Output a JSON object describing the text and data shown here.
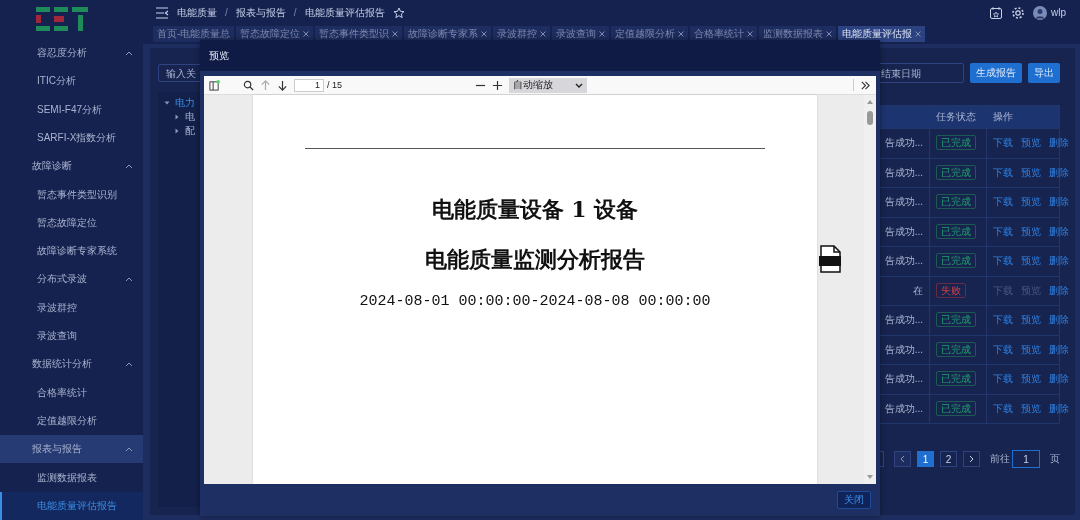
{
  "sidebar": {
    "items": [
      {
        "label": "容忍度分析",
        "kind": "subgroup",
        "expanded": true,
        "children": [
          {
            "label": "ITIC分析",
            "kind": "leaf",
            "selected": false
          },
          {
            "label": "SEMI-F47分析",
            "kind": "leaf",
            "selected": false
          },
          {
            "label": "SARFI-X指数分析",
            "kind": "leaf",
            "selected": false
          }
        ]
      },
      {
        "label": "故障诊断",
        "kind": "group",
        "expanded": true,
        "children": [
          {
            "label": "暂态事件类型识别",
            "kind": "leaf",
            "selected": false
          },
          {
            "label": "暂态故障定位",
            "kind": "leaf",
            "selected": false
          },
          {
            "label": "故障诊断专家系统",
            "kind": "leaf",
            "selected": false
          },
          {
            "label": "分布式录波",
            "kind": "subgroup",
            "expanded": true,
            "children": [
              {
                "label": "录波群控",
                "kind": "leaf",
                "selected": false
              },
              {
                "label": "录波查询",
                "kind": "leaf",
                "selected": false
              }
            ]
          }
        ]
      },
      {
        "label": "数据统计分析",
        "kind": "group",
        "expanded": true,
        "children": [
          {
            "label": "合格率统计",
            "kind": "leaf",
            "selected": false
          },
          {
            "label": "定值越限分析",
            "kind": "leaf",
            "selected": false
          }
        ]
      },
      {
        "label": "报表与报告",
        "kind": "group",
        "expanded": true,
        "children": [
          {
            "label": "监测数据报表",
            "kind": "leaf",
            "selected": false
          },
          {
            "label": "电能质量评估报告",
            "kind": "leaf",
            "selected": true
          }
        ]
      }
    ]
  },
  "breadcrumb": [
    "电能质量",
    "报表与报告",
    "电能质量评估报告"
  ],
  "breadcrumb_separator": "/",
  "user": {
    "name": "wlp"
  },
  "tabs": [
    {
      "label": "首页-电能质量总",
      "closable": false,
      "selected": false
    },
    {
      "label": "暂态故障定位",
      "closable": true,
      "selected": false
    },
    {
      "label": "暂态事件类型识",
      "closable": true,
      "selected": false
    },
    {
      "label": "故障诊断专家系",
      "closable": true,
      "selected": false
    },
    {
      "label": "录波群控",
      "closable": true,
      "selected": false
    },
    {
      "label": "录波查询",
      "closable": true,
      "selected": false
    },
    {
      "label": "定值越限分析",
      "closable": true,
      "selected": false
    },
    {
      "label": "合格率统计",
      "closable": true,
      "selected": false
    },
    {
      "label": "监测数据报表",
      "closable": true,
      "selected": false
    },
    {
      "label": "电能质量评估报",
      "closable": true,
      "selected": true
    }
  ],
  "toolbar": {
    "search": {
      "placeholder": "输入关"
    },
    "end_date": {
      "placeholder": "结束日期"
    },
    "buttons": [
      "生成报告",
      "导出"
    ]
  },
  "tree": [
    {
      "label": "电力",
      "expanded": true,
      "selected": true,
      "children": [
        {
          "label": "电",
          "expanded": false,
          "selected": false
        },
        {
          "label": "配",
          "expanded": false,
          "selected": false
        }
      ]
    }
  ],
  "table": {
    "columns": [
      "任务状态",
      "操作"
    ],
    "rows": [
      {
        "column_1": "告成功...",
        "status": {
          "text": "已完成",
          "kind": "success"
        },
        "actions": [
          {
            "label": "下载",
            "disabled": false
          },
          {
            "label": "预览",
            "disabled": false
          },
          {
            "label": "删除",
            "disabled": false
          }
        ]
      },
      {
        "column_1": "告成功...",
        "status": {
          "text": "已完成",
          "kind": "success"
        },
        "actions": [
          {
            "label": "下载",
            "disabled": false
          },
          {
            "label": "预览",
            "disabled": false
          },
          {
            "label": "删除",
            "disabled": false
          }
        ]
      },
      {
        "column_1": "告成功...",
        "status": {
          "text": "已完成",
          "kind": "success"
        },
        "actions": [
          {
            "label": "下载",
            "disabled": false
          },
          {
            "label": "预览",
            "disabled": false
          },
          {
            "label": "删除",
            "disabled": false
          }
        ]
      },
      {
        "column_1": "告成功...",
        "status": {
          "text": "已完成",
          "kind": "success"
        },
        "actions": [
          {
            "label": "下载",
            "disabled": false
          },
          {
            "label": "预览",
            "disabled": false
          },
          {
            "label": "删除",
            "disabled": false
          }
        ]
      },
      {
        "column_1": "告成功...",
        "status": {
          "text": "已完成",
          "kind": "success"
        },
        "actions": [
          {
            "label": "下载",
            "disabled": false
          },
          {
            "label": "预览",
            "disabled": false
          },
          {
            "label": "删除",
            "disabled": false
          }
        ]
      },
      {
        "column_1": "在",
        "status": {
          "text": "失败",
          "kind": "fail"
        },
        "actions": [
          {
            "label": "下载",
            "disabled": true
          },
          {
            "label": "预览",
            "disabled": true
          },
          {
            "label": "删除",
            "disabled": false
          }
        ]
      },
      {
        "column_1": "告成功...",
        "status": {
          "text": "已完成",
          "kind": "success"
        },
        "actions": [
          {
            "label": "下载",
            "disabled": false
          },
          {
            "label": "预览",
            "disabled": false
          },
          {
            "label": "删除",
            "disabled": false
          }
        ]
      },
      {
        "column_1": "告成功...",
        "status": {
          "text": "已完成",
          "kind": "success"
        },
        "actions": [
          {
            "label": "下载",
            "disabled": false
          },
          {
            "label": "预览",
            "disabled": false
          },
          {
            "label": "删除",
            "disabled": false
          }
        ]
      },
      {
        "column_1": "告成功...",
        "status": {
          "text": "已完成",
          "kind": "success"
        },
        "actions": [
          {
            "label": "下载",
            "disabled": false
          },
          {
            "label": "预览",
            "disabled": false
          },
          {
            "label": "删除",
            "disabled": false
          }
        ]
      },
      {
        "column_1": "告成功...",
        "status": {
          "text": "已完成",
          "kind": "success"
        },
        "actions": [
          {
            "label": "下载",
            "disabled": false
          },
          {
            "label": "预览",
            "disabled": false
          },
          {
            "label": "删除",
            "disabled": false
          }
        ]
      }
    ]
  },
  "pagination": {
    "prev": {
      "disabled": true
    },
    "pages": [
      {
        "label": "1",
        "selected": true
      },
      {
        "label": "2",
        "selected": false
      }
    ],
    "goto_label": "前往",
    "goto_value": "1",
    "page_unit": "页"
  },
  "modal": {
    "title": "预览",
    "close_button": "关闭",
    "pdf": {
      "up": {
        "disabled": true
      },
      "down": {
        "disabled": false
      },
      "page": "1",
      "page_count": "/ 15",
      "zoom": "自动缩放",
      "lines": [
        "电能质量设备 1 设备",
        "电能质量监测分析报告",
        "2024-08-01 00:00:00-2024-08-08 00:00:00"
      ]
    }
  }
}
